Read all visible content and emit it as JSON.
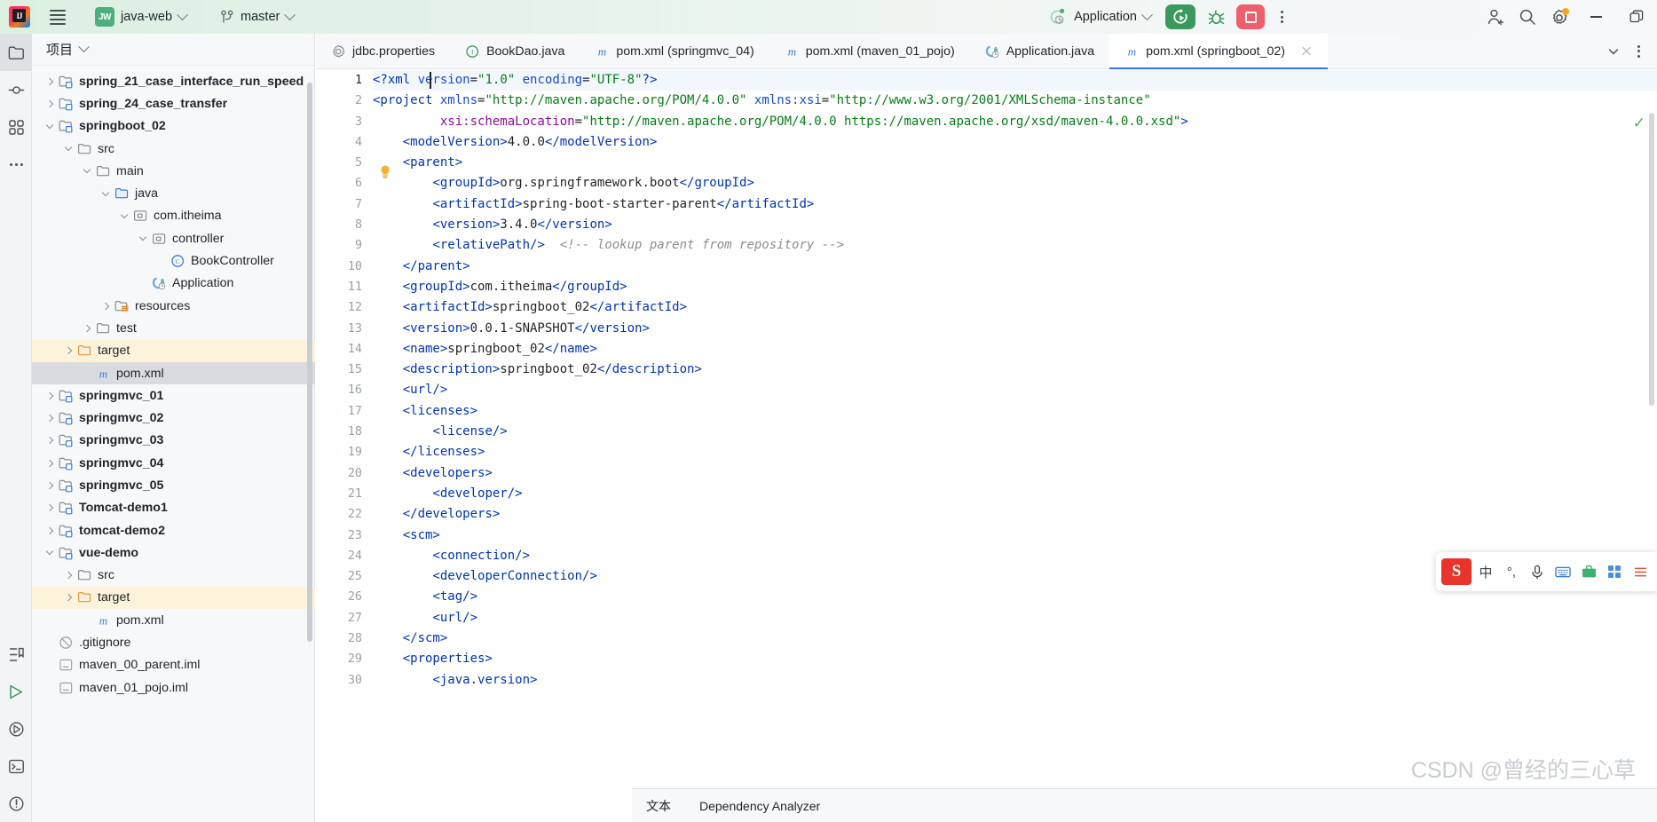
{
  "titlebar": {
    "menu_icon": "hamburger-menu-icon",
    "project_badge": "JW",
    "project_name": "java-web",
    "vcs_icon": "git-branch-icon",
    "branch_name": "master",
    "run_config_icon": "spring-boot-run-config-icon",
    "run_config_name": "Application",
    "run_label": "Run",
    "debug_label": "Debug",
    "stop_label": "Stop",
    "more_label": "More actions",
    "account_label": "Account",
    "search_label": "Search Everywhere",
    "settings_label": "Settings",
    "minimize_label": "Minimize",
    "maximize_label": "Maximize",
    "accent_green": "#3a9a5d",
    "accent_red": "#ef5f6b",
    "badge_orange": "#f5a623"
  },
  "rail": {
    "top_items": [
      {
        "name": "project-tool-window",
        "icon": "folder-icon",
        "selected": true
      },
      {
        "name": "commit-tool-window",
        "icon": "commit-icon",
        "selected": false
      },
      {
        "name": "structure-tool-window",
        "icon": "structure-icon",
        "selected": false
      },
      {
        "name": "more-tool-windows",
        "icon": "ellipsis-icon",
        "selected": false
      }
    ],
    "bottom_items": [
      {
        "name": "bookmarks-tool-window",
        "icon": "bookmarks-icon"
      },
      {
        "name": "run-tool-window",
        "icon": "run-icon"
      },
      {
        "name": "services-tool-window",
        "icon": "services-icon"
      },
      {
        "name": "terminal-tool-window",
        "icon": "terminal-icon"
      },
      {
        "name": "problems-tool-window",
        "icon": "problems-icon"
      }
    ]
  },
  "project_panel": {
    "title": "项目",
    "tree": [
      {
        "label": "spring_21_case_interface_run_speed",
        "depth": 1,
        "arrow": "right",
        "icon": "module-folder-icon",
        "bold": true,
        "state": "none"
      },
      {
        "label": "spring_24_case_transfer",
        "depth": 1,
        "arrow": "right",
        "icon": "module-folder-icon",
        "bold": true,
        "state": "none"
      },
      {
        "label": "springboot_02",
        "depth": 1,
        "arrow": "down",
        "icon": "module-folder-icon",
        "bold": true,
        "state": "none"
      },
      {
        "label": "src",
        "depth": 2,
        "arrow": "down",
        "icon": "folder-icon",
        "bold": false,
        "state": "none"
      },
      {
        "label": "main",
        "depth": 3,
        "arrow": "down",
        "icon": "folder-icon",
        "bold": false,
        "state": "none"
      },
      {
        "label": "java",
        "depth": 4,
        "arrow": "down",
        "icon": "source-folder-icon",
        "bold": false,
        "state": "none"
      },
      {
        "label": "com.itheima",
        "depth": 5,
        "arrow": "down",
        "icon": "package-icon",
        "bold": false,
        "state": "none"
      },
      {
        "label": "controller",
        "depth": 6,
        "arrow": "down",
        "icon": "package-icon",
        "bold": false,
        "state": "none"
      },
      {
        "label": "BookController",
        "depth": 7,
        "arrow": "none",
        "icon": "java-class-icon",
        "bold": false,
        "state": "none"
      },
      {
        "label": "Application",
        "depth": 6,
        "arrow": "none",
        "icon": "spring-boot-class-icon",
        "bold": false,
        "state": "none"
      },
      {
        "label": "resources",
        "depth": 4,
        "arrow": "right",
        "icon": "resources-folder-icon",
        "bold": false,
        "state": "none"
      },
      {
        "label": "test",
        "depth": 3,
        "arrow": "right",
        "icon": "folder-icon",
        "bold": false,
        "state": "none"
      },
      {
        "label": "target",
        "depth": 2,
        "arrow": "right",
        "icon": "excluded-folder-icon",
        "bold": false,
        "state": "target"
      },
      {
        "label": "pom.xml",
        "depth": 3,
        "arrow": "none",
        "icon": "maven-icon",
        "bold": false,
        "state": "selected"
      },
      {
        "label": "springmvc_01",
        "depth": 1,
        "arrow": "right",
        "icon": "module-folder-icon",
        "bold": true,
        "state": "none"
      },
      {
        "label": "springmvc_02",
        "depth": 1,
        "arrow": "right",
        "icon": "module-folder-icon",
        "bold": true,
        "state": "none"
      },
      {
        "label": "springmvc_03",
        "depth": 1,
        "arrow": "right",
        "icon": "module-folder-icon",
        "bold": true,
        "state": "none"
      },
      {
        "label": "springmvc_04",
        "depth": 1,
        "arrow": "right",
        "icon": "module-folder-icon",
        "bold": true,
        "state": "none"
      },
      {
        "label": "springmvc_05",
        "depth": 1,
        "arrow": "right",
        "icon": "module-folder-icon",
        "bold": true,
        "state": "none"
      },
      {
        "label": "Tomcat-demo1",
        "depth": 1,
        "arrow": "right",
        "icon": "module-folder-icon",
        "bold": true,
        "state": "none"
      },
      {
        "label": "tomcat-demo2",
        "depth": 1,
        "arrow": "right",
        "icon": "module-folder-icon",
        "bold": true,
        "state": "none"
      },
      {
        "label": "vue-demo",
        "depth": 1,
        "arrow": "down",
        "icon": "module-folder-icon",
        "bold": true,
        "state": "none"
      },
      {
        "label": "src",
        "depth": 2,
        "arrow": "right",
        "icon": "folder-icon",
        "bold": false,
        "state": "none"
      },
      {
        "label": "target",
        "depth": 2,
        "arrow": "right",
        "icon": "excluded-folder-icon",
        "bold": false,
        "state": "target"
      },
      {
        "label": "pom.xml",
        "depth": 3,
        "arrow": "none",
        "icon": "maven-icon",
        "bold": false,
        "state": "none"
      },
      {
        "label": ".gitignore",
        "depth": 1,
        "arrow": "none",
        "icon": "gitignore-icon",
        "bold": false,
        "state": "none"
      },
      {
        "label": "maven_00_parent.iml",
        "depth": 1,
        "arrow": "none",
        "icon": "iml-icon",
        "bold": false,
        "state": "none"
      },
      {
        "label": "maven_01_pojo.iml",
        "depth": 1,
        "arrow": "none",
        "icon": "iml-icon",
        "bold": false,
        "state": "none"
      }
    ]
  },
  "editor": {
    "tabs": [
      {
        "label": "jdbc.properties",
        "icon": "properties-icon",
        "active": false
      },
      {
        "label": "BookDao.java",
        "icon": "java-interface-icon",
        "active": false
      },
      {
        "label": "pom.xml (springmvc_04)",
        "icon": "maven-icon",
        "active": false
      },
      {
        "label": "pom.xml (maven_01_pojo)",
        "icon": "maven-icon",
        "active": false
      },
      {
        "label": "Application.java",
        "icon": "spring-boot-class-icon",
        "active": false
      },
      {
        "label": "pom.xml (springboot_02)",
        "icon": "maven-icon",
        "active": true
      }
    ],
    "tab_close_label": "Close tab",
    "tab_list_label": "Show tab list",
    "tab_options_label": "Tab options",
    "inspection_status": "no-errors-checkmark",
    "intention_bulb": "intention-bulb-icon",
    "lines": [
      {
        "n": 1,
        "current": true,
        "tokens": [
          {
            "t": "<?xml ",
            "c": "tg"
          },
          {
            "t": "version",
            "c": "at"
          },
          {
            "t": "=",
            "c": "txt"
          },
          {
            "t": "\"1.0\"",
            "c": "val"
          },
          {
            "t": " ",
            "c": "txt"
          },
          {
            "t": "encoding",
            "c": "at"
          },
          {
            "t": "=",
            "c": "txt"
          },
          {
            "t": "\"UTF-8\"",
            "c": "val"
          },
          {
            "t": "?>",
            "c": "tg"
          }
        ]
      },
      {
        "n": 2,
        "current": false,
        "tokens": [
          {
            "t": "<project ",
            "c": "tg"
          },
          {
            "t": "xmlns",
            "c": "at"
          },
          {
            "t": "=",
            "c": "txt"
          },
          {
            "t": "\"http://maven.apache.org/POM/4.0.0\"",
            "c": "val"
          },
          {
            "t": " ",
            "c": "txt"
          },
          {
            "t": "xmlns:xsi",
            "c": "at"
          },
          {
            "t": "=",
            "c": "txt"
          },
          {
            "t": "\"http://www.w3.org/2001/XMLSchema-instance\"",
            "c": "val"
          }
        ]
      },
      {
        "n": 3,
        "current": false,
        "tokens": [
          {
            "t": "         ",
            "c": "txt"
          },
          {
            "t": "xsi:schemaLocation",
            "c": "pur"
          },
          {
            "t": "=",
            "c": "txt"
          },
          {
            "t": "\"http://maven.apache.org/POM/4.0.0 https://maven.apache.org/xsd/maven-4.0.0.xsd\"",
            "c": "val"
          },
          {
            "t": ">",
            "c": "tg"
          }
        ]
      },
      {
        "n": 4,
        "current": false,
        "tokens": [
          {
            "t": "    ",
            "c": "txt"
          },
          {
            "t": "<modelVersion>",
            "c": "tg"
          },
          {
            "t": "4.0.0",
            "c": "txt"
          },
          {
            "t": "</modelVersion>",
            "c": "tg"
          }
        ]
      },
      {
        "n": 5,
        "current": false,
        "tokens": [
          {
            "t": "    ",
            "c": "txt"
          },
          {
            "t": "<parent>",
            "c": "tg"
          }
        ]
      },
      {
        "n": 6,
        "current": false,
        "tokens": [
          {
            "t": "        ",
            "c": "txt"
          },
          {
            "t": "<groupId>",
            "c": "tg"
          },
          {
            "t": "org.springframework.boot",
            "c": "txt"
          },
          {
            "t": "</groupId>",
            "c": "tg"
          }
        ]
      },
      {
        "n": 7,
        "current": false,
        "tokens": [
          {
            "t": "        ",
            "c": "txt"
          },
          {
            "t": "<artifactId>",
            "c": "tg"
          },
          {
            "t": "spring-boot-starter-parent",
            "c": "txt"
          },
          {
            "t": "</artifactId>",
            "c": "tg"
          }
        ]
      },
      {
        "n": 8,
        "current": false,
        "tokens": [
          {
            "t": "        ",
            "c": "txt"
          },
          {
            "t": "<version>",
            "c": "tg"
          },
          {
            "t": "3.4.0",
            "c": "txt"
          },
          {
            "t": "</version>",
            "c": "tg"
          }
        ]
      },
      {
        "n": 9,
        "current": false,
        "tokens": [
          {
            "t": "        ",
            "c": "txt"
          },
          {
            "t": "<relativePath/>",
            "c": "tg"
          },
          {
            "t": "  <!-- lookup parent from repository -->",
            "c": "cm"
          }
        ]
      },
      {
        "n": 10,
        "current": false,
        "tokens": [
          {
            "t": "    ",
            "c": "txt"
          },
          {
            "t": "</parent>",
            "c": "tg"
          }
        ]
      },
      {
        "n": 11,
        "current": false,
        "tokens": [
          {
            "t": "    ",
            "c": "txt"
          },
          {
            "t": "<groupId>",
            "c": "tg"
          },
          {
            "t": "com.itheima",
            "c": "txt"
          },
          {
            "t": "</groupId>",
            "c": "tg"
          }
        ]
      },
      {
        "n": 12,
        "current": false,
        "tokens": [
          {
            "t": "    ",
            "c": "txt"
          },
          {
            "t": "<artifactId>",
            "c": "tg"
          },
          {
            "t": "springboot_02",
            "c": "txt"
          },
          {
            "t": "</artifactId>",
            "c": "tg"
          }
        ]
      },
      {
        "n": 13,
        "current": false,
        "tokens": [
          {
            "t": "    ",
            "c": "txt"
          },
          {
            "t": "<version>",
            "c": "tg"
          },
          {
            "t": "0.0.1-SNAPSHOT",
            "c": "txt"
          },
          {
            "t": "</version>",
            "c": "tg"
          }
        ]
      },
      {
        "n": 14,
        "current": false,
        "tokens": [
          {
            "t": "    ",
            "c": "txt"
          },
          {
            "t": "<name>",
            "c": "tg"
          },
          {
            "t": "springboot_02",
            "c": "txt"
          },
          {
            "t": "</name>",
            "c": "tg"
          }
        ]
      },
      {
        "n": 15,
        "current": false,
        "tokens": [
          {
            "t": "    ",
            "c": "txt"
          },
          {
            "t": "<description>",
            "c": "tg"
          },
          {
            "t": "springboot_02",
            "c": "txt"
          },
          {
            "t": "</description>",
            "c": "tg"
          }
        ]
      },
      {
        "n": 16,
        "current": false,
        "tokens": [
          {
            "t": "    ",
            "c": "txt"
          },
          {
            "t": "<url/>",
            "c": "tg"
          }
        ]
      },
      {
        "n": 17,
        "current": false,
        "tokens": [
          {
            "t": "    ",
            "c": "txt"
          },
          {
            "t": "<licenses>",
            "c": "tg"
          }
        ]
      },
      {
        "n": 18,
        "current": false,
        "tokens": [
          {
            "t": "        ",
            "c": "txt"
          },
          {
            "t": "<license/>",
            "c": "tg"
          }
        ]
      },
      {
        "n": 19,
        "current": false,
        "tokens": [
          {
            "t": "    ",
            "c": "txt"
          },
          {
            "t": "</licenses>",
            "c": "tg"
          }
        ]
      },
      {
        "n": 20,
        "current": false,
        "tokens": [
          {
            "t": "    ",
            "c": "txt"
          },
          {
            "t": "<developers>",
            "c": "tg"
          }
        ]
      },
      {
        "n": 21,
        "current": false,
        "tokens": [
          {
            "t": "        ",
            "c": "txt"
          },
          {
            "t": "<developer/>",
            "c": "tg"
          }
        ]
      },
      {
        "n": 22,
        "current": false,
        "tokens": [
          {
            "t": "    ",
            "c": "txt"
          },
          {
            "t": "</developers>",
            "c": "tg"
          }
        ]
      },
      {
        "n": 23,
        "current": false,
        "tokens": [
          {
            "t": "    ",
            "c": "txt"
          },
          {
            "t": "<scm>",
            "c": "tg"
          }
        ]
      },
      {
        "n": 24,
        "current": false,
        "tokens": [
          {
            "t": "        ",
            "c": "txt"
          },
          {
            "t": "<connection/>",
            "c": "tg"
          }
        ]
      },
      {
        "n": 25,
        "current": false,
        "tokens": [
          {
            "t": "        ",
            "c": "txt"
          },
          {
            "t": "<developerConnection/>",
            "c": "tg"
          }
        ]
      },
      {
        "n": 26,
        "current": false,
        "tokens": [
          {
            "t": "        ",
            "c": "txt"
          },
          {
            "t": "<tag/>",
            "c": "tg"
          }
        ]
      },
      {
        "n": 27,
        "current": false,
        "tokens": [
          {
            "t": "        ",
            "c": "txt"
          },
          {
            "t": "<url/>",
            "c": "tg"
          }
        ]
      },
      {
        "n": 28,
        "current": false,
        "tokens": [
          {
            "t": "    ",
            "c": "txt"
          },
          {
            "t": "</scm>",
            "c": "tg"
          }
        ]
      },
      {
        "n": 29,
        "current": false,
        "tokens": [
          {
            "t": "    ",
            "c": "txt"
          },
          {
            "t": "<properties>",
            "c": "tg"
          }
        ]
      },
      {
        "n": 30,
        "current": false,
        "tokens": [
          {
            "t": "        ",
            "c": "txt"
          },
          {
            "t": "<java.version>",
            "c": "tg"
          }
        ]
      }
    ]
  },
  "statusbar": {
    "encoding_or_mode": "文本",
    "dependency_analyzer": "Dependency Analyzer"
  },
  "ime": {
    "logo": "S",
    "buttons": [
      "中",
      "°,",
      "microphone-icon",
      "keyboard-icon",
      "toolbox-icon",
      "grid-icon",
      "menu-icon"
    ]
  },
  "watermark": "CSDN @曾经的三心草"
}
